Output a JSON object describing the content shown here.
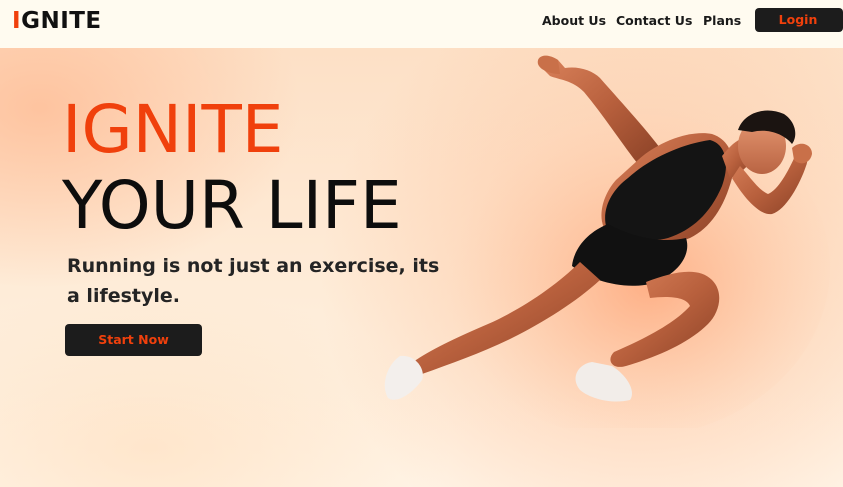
{
  "brand": {
    "logo_accent": "I",
    "logo_rest": "GNITE",
    "accent_color": "#f0400c",
    "dark_color": "#1c1c1c"
  },
  "nav": {
    "about": "About Us",
    "contact": "Contact Us",
    "plans": "Plans",
    "login": "Login"
  },
  "hero": {
    "title_line1": "IGNITE",
    "title_line2": "YOUR LIFE",
    "subtitle": "Running is not just an exercise, its a lifestyle.",
    "cta": "Start Now",
    "image": "sprinter-athlete-photo"
  }
}
